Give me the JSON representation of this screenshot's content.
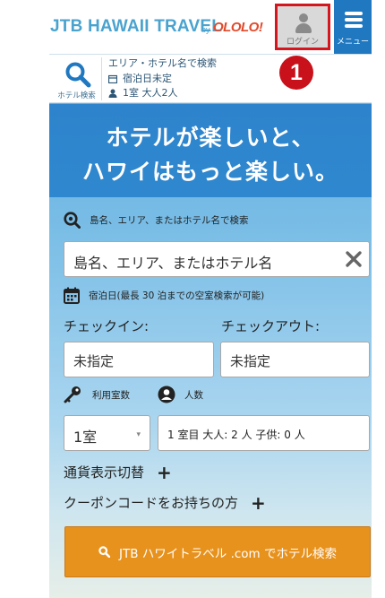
{
  "header": {
    "logo_text": "JTB HAWAII TRAVEL",
    "logo_by": "by",
    "logo_partner": "OLOLO!",
    "login_label": "ログイン",
    "menu_label": "メニュー",
    "step_badge": "1",
    "highlight_color": "#d4171f"
  },
  "summary": {
    "search_label": "ホテル検索",
    "destination": "エリア・ホテル名で検索",
    "dates": "宿泊日未定",
    "guests": "1室 大人2人"
  },
  "hero": {
    "line1": "ホテルが楽しいと、",
    "line2": "ハワイはもっと楽しい。"
  },
  "form": {
    "destination_heading": "島名、エリア、またはホテル名で検索",
    "destination_placeholder": "島名、エリア、またはホテル名",
    "dates_heading": "宿泊日(最長 30 泊までの空室検索が可能)",
    "checkin_label": "チェックイン:",
    "checkin_value": "未指定",
    "checkout_label": "チェックアウト:",
    "checkout_value": "未指定",
    "rooms_heading": "利用室数",
    "guests_heading": "人数",
    "rooms_value": "1室",
    "guests_value": "1 室目 大人: 2 人 子供: 0 人",
    "currency_toggle": "通貨表示切替",
    "coupon_toggle": "クーポンコードをお持ちの方",
    "plus_symbol": "+",
    "search_button": "JTB ハワイトラベル .com でホテル検索",
    "button_color": "#e8921e"
  }
}
